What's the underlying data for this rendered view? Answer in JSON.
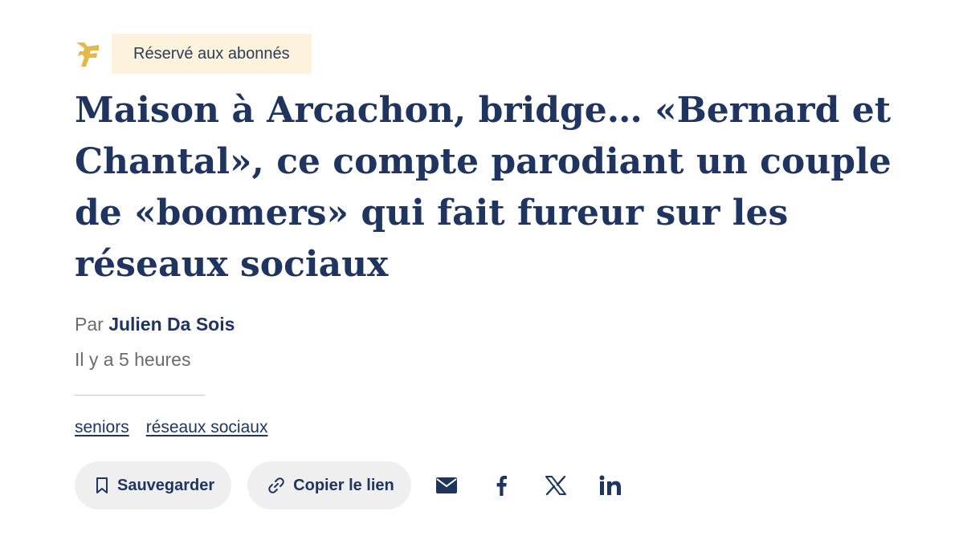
{
  "badge": {
    "label": "Réservé aux abonnés"
  },
  "logo": {
    "icon": "le-figaro-logo-icon",
    "color": "#e5b84b"
  },
  "article": {
    "title": "Maison à Arcachon, bridge… «Bernard et Chantal», ce compte parodiant un couple de «boomers» qui fait fureur sur les réseaux sociaux",
    "byline_prefix": "Par",
    "author": "Julien Da Sois",
    "timestamp": "Il y a 5 heures"
  },
  "tags": [
    {
      "label": "seniors"
    },
    {
      "label": "réseaux sociaux"
    }
  ],
  "actions": {
    "save_label": "Sauvegarder",
    "save_icon": "bookmark-icon",
    "copy_label": "Copier le lien",
    "copy_icon": "link-icon"
  },
  "share": [
    {
      "icon": "email-icon"
    },
    {
      "icon": "facebook-icon"
    },
    {
      "icon": "x-icon"
    },
    {
      "icon": "linkedin-icon"
    }
  ],
  "colors": {
    "primary": "#1f3560",
    "badge_bg": "#fdf3dd",
    "meta_gray": "#6b6b6b",
    "pill_bg": "#efefef"
  }
}
